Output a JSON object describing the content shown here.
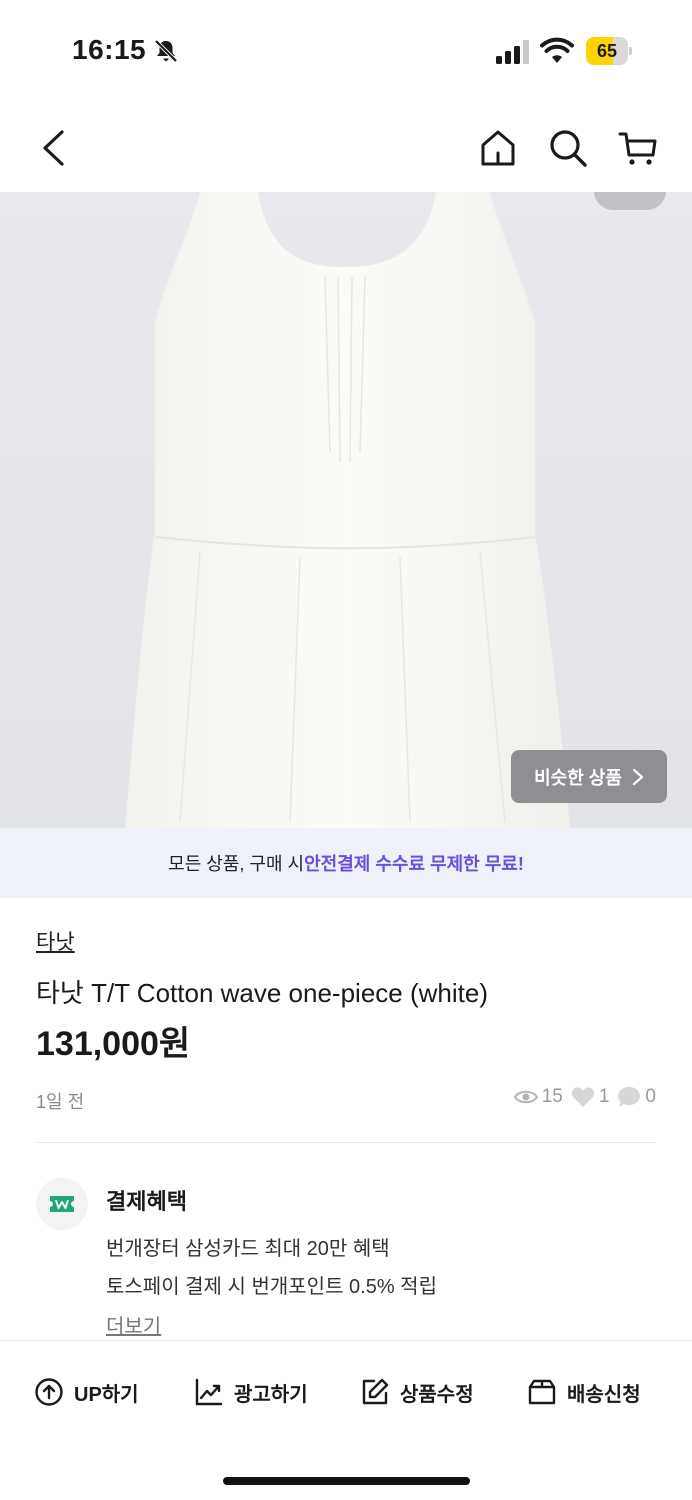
{
  "status_bar": {
    "time": "16:15",
    "battery": "65",
    "battery_level": 0.65
  },
  "nav": {
    "back_icon": "chevron-left-icon",
    "home_icon": "home-icon",
    "search_icon": "search-icon",
    "cart_icon": "cart-icon"
  },
  "hero": {
    "similar_label": "비슷한 상품"
  },
  "promo": {
    "prefix": "모든 상품, 구매 시 ",
    "highlight": "안전결제 수수료 무제한 무료!"
  },
  "product": {
    "shop_name": "타낫",
    "title": "타낫 T/T Cotton wave one-piece (white)",
    "price": "131,000원",
    "posted": "1일 전",
    "views": "15",
    "likes": "1",
    "chats": "0"
  },
  "benefits": {
    "title": "결제혜택",
    "line1": "번개장터 삼성카드 최대 20만 혜택",
    "line2": "토스페이 결제 시 번개포인트 0.5% 적립",
    "more": "더보기"
  },
  "actions": [
    {
      "label": "UP하기",
      "icon": "arrow-up-circle-icon"
    },
    {
      "label": "광고하기",
      "icon": "trend-chart-icon"
    },
    {
      "label": "상품수정",
      "icon": "edit-icon"
    },
    {
      "label": "배송신청",
      "icon": "box-icon"
    }
  ],
  "colors": {
    "accent": "#6b4ed9",
    "benefit_green": "#1fa67a",
    "battery": "#ffd400"
  }
}
